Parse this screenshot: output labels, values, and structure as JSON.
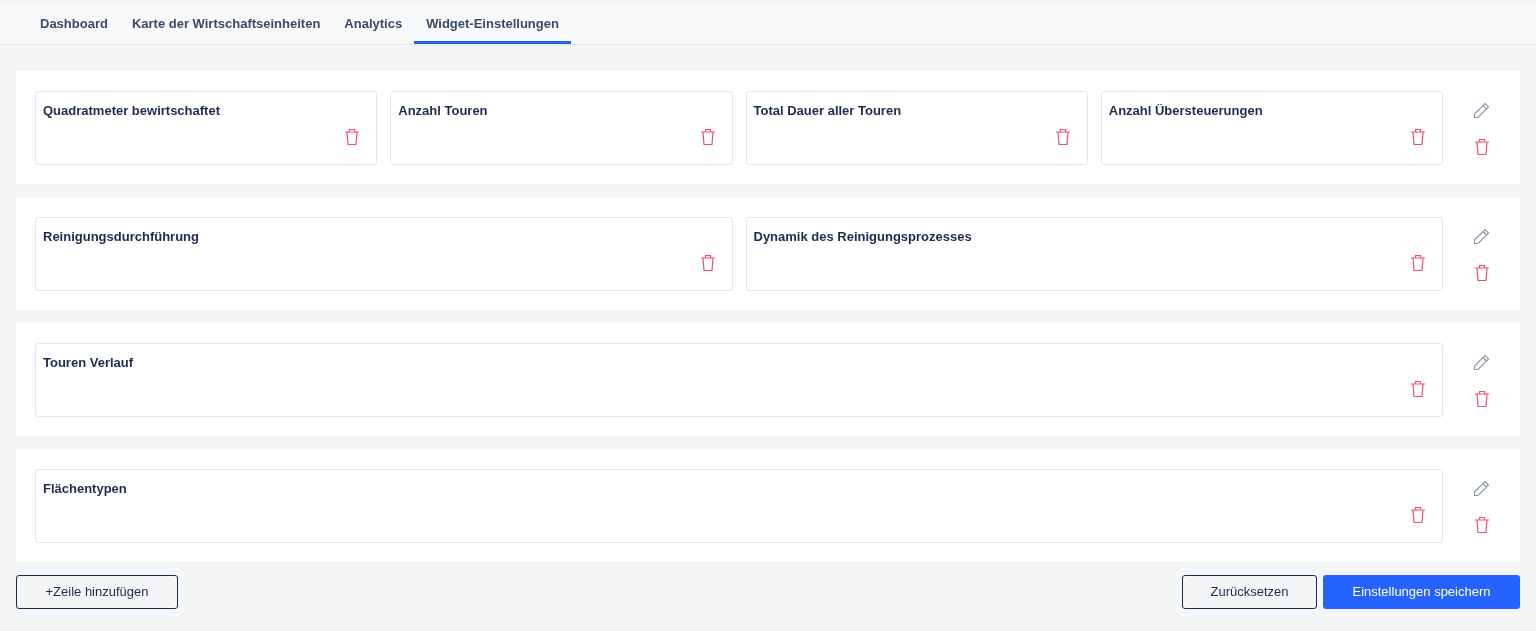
{
  "tabs": [
    {
      "label": "Dashboard",
      "selected": false
    },
    {
      "label": "Karte der Wirtschaftseinheiten",
      "selected": false
    },
    {
      "label": "Analytics",
      "selected": false
    },
    {
      "label": "Widget-Einstellungen",
      "selected": true
    }
  ],
  "rows": [
    {
      "widgets": [
        {
          "title": "Quadratmeter bewirtschaftet"
        },
        {
          "title": "Anzahl Touren"
        },
        {
          "title": "Total Dauer aller Touren"
        },
        {
          "title": "Anzahl Übersteuerungen"
        }
      ]
    },
    {
      "widgets": [
        {
          "title": "Reinigungsdurchführung"
        },
        {
          "title": "Dynamik des Reinigungsprozesses"
        }
      ]
    },
    {
      "widgets": [
        {
          "title": "Touren Verlauf"
        }
      ]
    },
    {
      "widgets": [
        {
          "title": "Flächentypen"
        }
      ]
    }
  ],
  "add_row_button": "+Zeile hinzufügen",
  "reset_button": "Zurücksetzen",
  "save_button": "Einstellungen speichern"
}
